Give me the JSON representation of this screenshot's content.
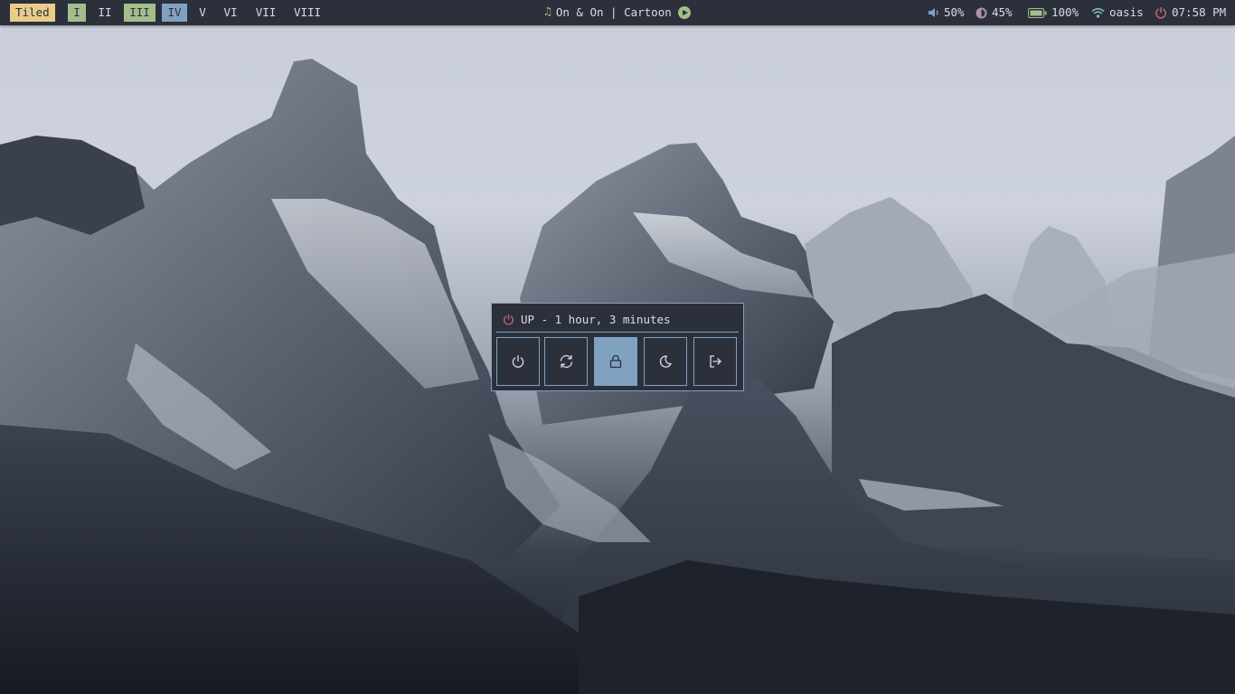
{
  "topbar": {
    "layout_label": "Tiled",
    "workspaces": [
      {
        "label": "I",
        "state": "occupied"
      },
      {
        "label": "II",
        "state": "empty"
      },
      {
        "label": "III",
        "state": "occupied"
      },
      {
        "label": "IV",
        "state": "focused"
      },
      {
        "label": "V",
        "state": "empty"
      },
      {
        "label": "VI",
        "state": "empty"
      },
      {
        "label": "VII",
        "state": "empty"
      },
      {
        "label": "VIII",
        "state": "empty"
      }
    ],
    "media": {
      "text": "On & On | Cartoon",
      "icon": "music-note-icon",
      "control_icon": "play-icon"
    },
    "volume": {
      "icon": "speaker-icon",
      "value": "50%"
    },
    "brightness": {
      "icon": "brightness-icon",
      "value": "45%"
    },
    "battery": {
      "icon": "battery-icon",
      "value": "100%"
    },
    "network": {
      "icon": "wifi-icon",
      "value": "oasis"
    },
    "clock": {
      "icon": "power-icon",
      "value": "07:58 PM"
    }
  },
  "power_menu": {
    "uptime_icon": "power-icon",
    "uptime_text": "UP - 1 hour, 3 minutes",
    "buttons": [
      {
        "name": "shutdown",
        "icon": "power-icon"
      },
      {
        "name": "reboot",
        "icon": "refresh-icon"
      },
      {
        "name": "lock",
        "icon": "lock-icon",
        "active": true
      },
      {
        "name": "suspend",
        "icon": "moon-icon"
      },
      {
        "name": "logout",
        "icon": "logout-icon"
      }
    ]
  },
  "colors": {
    "bar_bg": "#2b303b",
    "foreground": "#d8dee9",
    "yellow": "#ebcb8b",
    "green": "#a3be8c",
    "blue": "#81a1c1",
    "red": "#bf616a",
    "purple": "#b48ead"
  }
}
